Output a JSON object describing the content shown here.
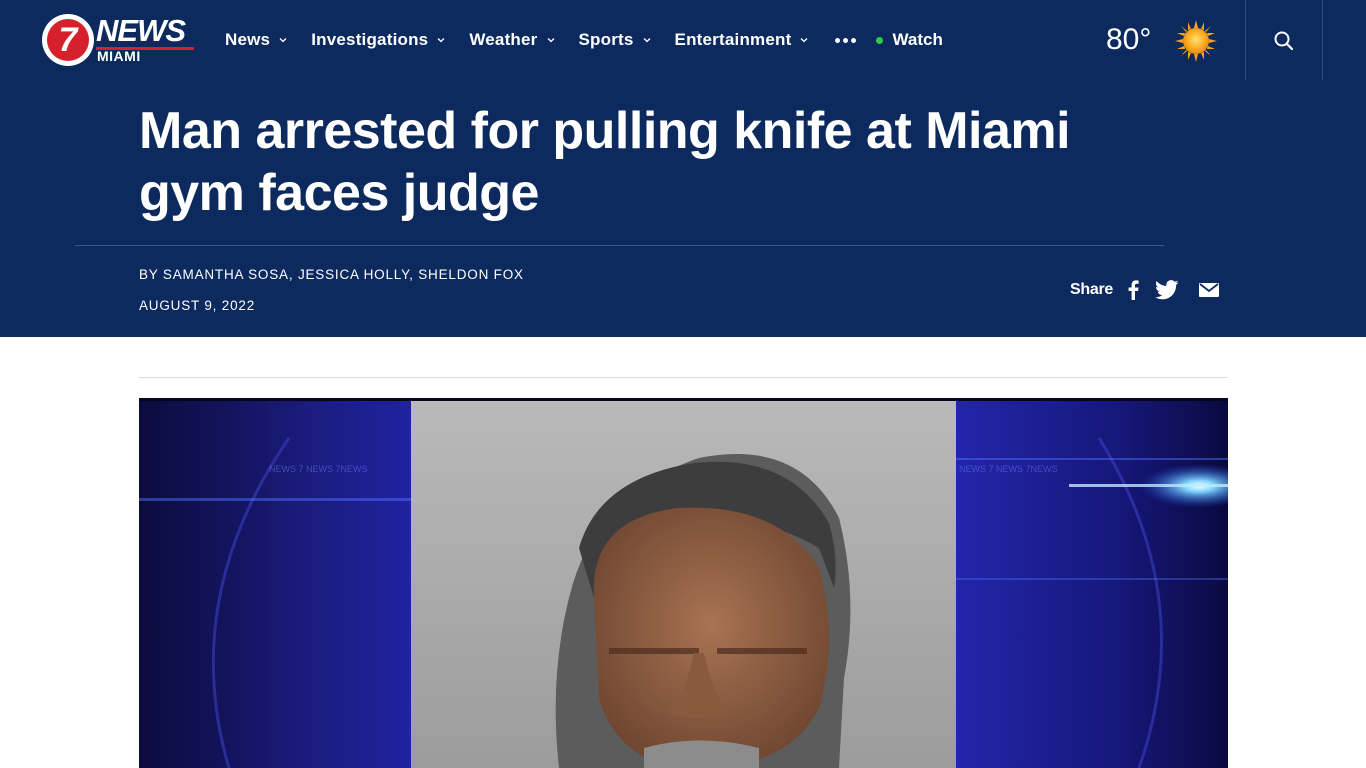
{
  "brand": {
    "logo_number": "7",
    "logo_word": "NEWS",
    "logo_city": "MIAMI",
    "accent_red": "#d6212d",
    "header_blue": "#0d2a5e"
  },
  "nav": {
    "items": [
      {
        "label": "News",
        "icon": "chevron-down-icon"
      },
      {
        "label": "Investigations",
        "icon": "chevron-down-icon"
      },
      {
        "label": "Weather",
        "icon": "chevron-down-icon"
      },
      {
        "label": "Sports",
        "icon": "chevron-down-icon"
      },
      {
        "label": "Entertainment",
        "icon": "chevron-down-icon"
      }
    ],
    "more_icon": "more-dots-icon",
    "watch_label": "Watch"
  },
  "weather": {
    "temperature": "80°",
    "condition_icon": "sun-icon"
  },
  "search_icon": "search-icon",
  "article": {
    "headline": "Man arrested for pulling knife at Miami gym faces judge",
    "byline": "BY SAMANTHA SOSA, JESSICA HOLLY, SHELDON FOX",
    "date": "AUGUST 9, 2022",
    "share_label": "Share",
    "share_icons": [
      "facebook-icon",
      "twitter-icon",
      "email-icon"
    ],
    "hero_overlay_text": "NEWS 7 NEWS 7NEWS"
  }
}
